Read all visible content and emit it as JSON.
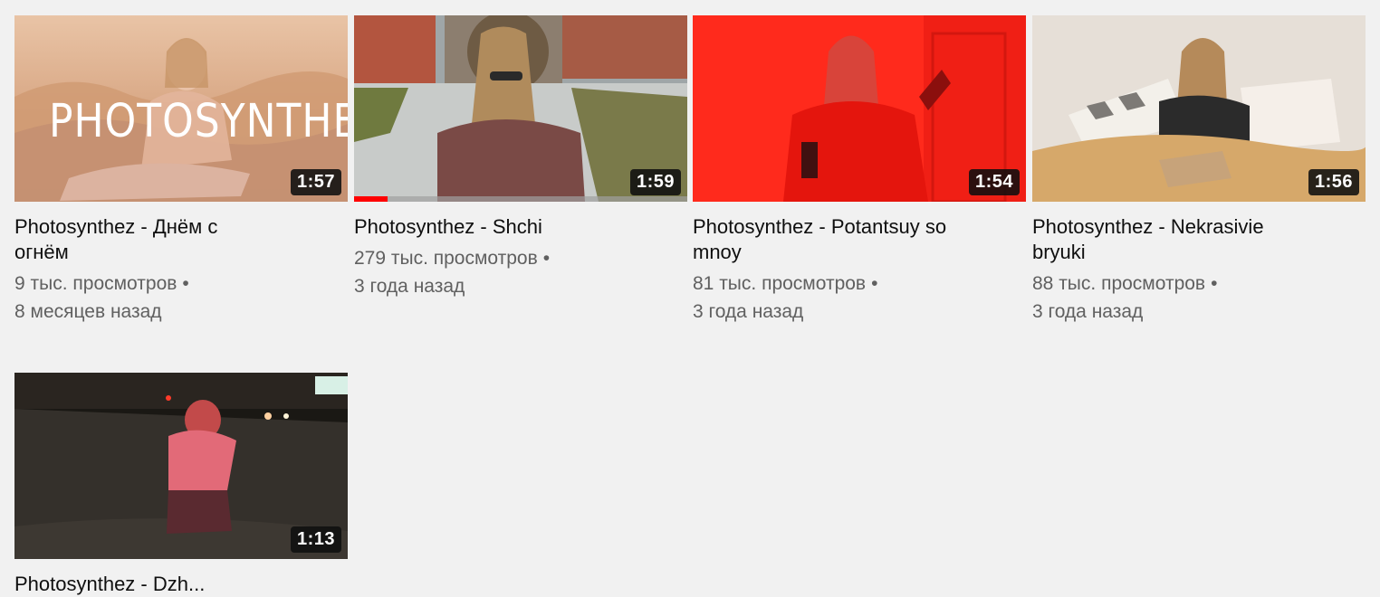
{
  "videos": [
    {
      "title_line1": "Photosynthez - Днём с",
      "title_line2": "огнём",
      "views": "9 тыс. просмотров",
      "age": "8 месяцев назад",
      "duration": "1:57",
      "thumb_text": "PHOTOSYNTHEZ"
    },
    {
      "title_line1": "Photosynthez - Shchi",
      "title_line2": "",
      "views": "279 тыс. просмотров",
      "age": "3 года назад",
      "duration": "1:59",
      "watch_progress": 0.1
    },
    {
      "title_line1": "Photosynthez - Potantsuy so",
      "title_line2": "mnoy",
      "views": "81 тыс. просмотров",
      "age": "3 года назад",
      "duration": "1:54"
    },
    {
      "title_line1": "Photosynthez - Nekrasivie",
      "title_line2": "bryuki",
      "views": "88 тыс. просмотров",
      "age": "3 года назад",
      "duration": "1:56"
    },
    {
      "title_line1": "Photosynthez - Dzh...",
      "title_line2": "",
      "views": "",
      "age": "",
      "duration": "1:13"
    }
  ],
  "separator": "•",
  "colors": {
    "background": "#f1f1f1",
    "progress": "#ff0000",
    "title": "#0f0f0f",
    "meta": "#606060"
  }
}
